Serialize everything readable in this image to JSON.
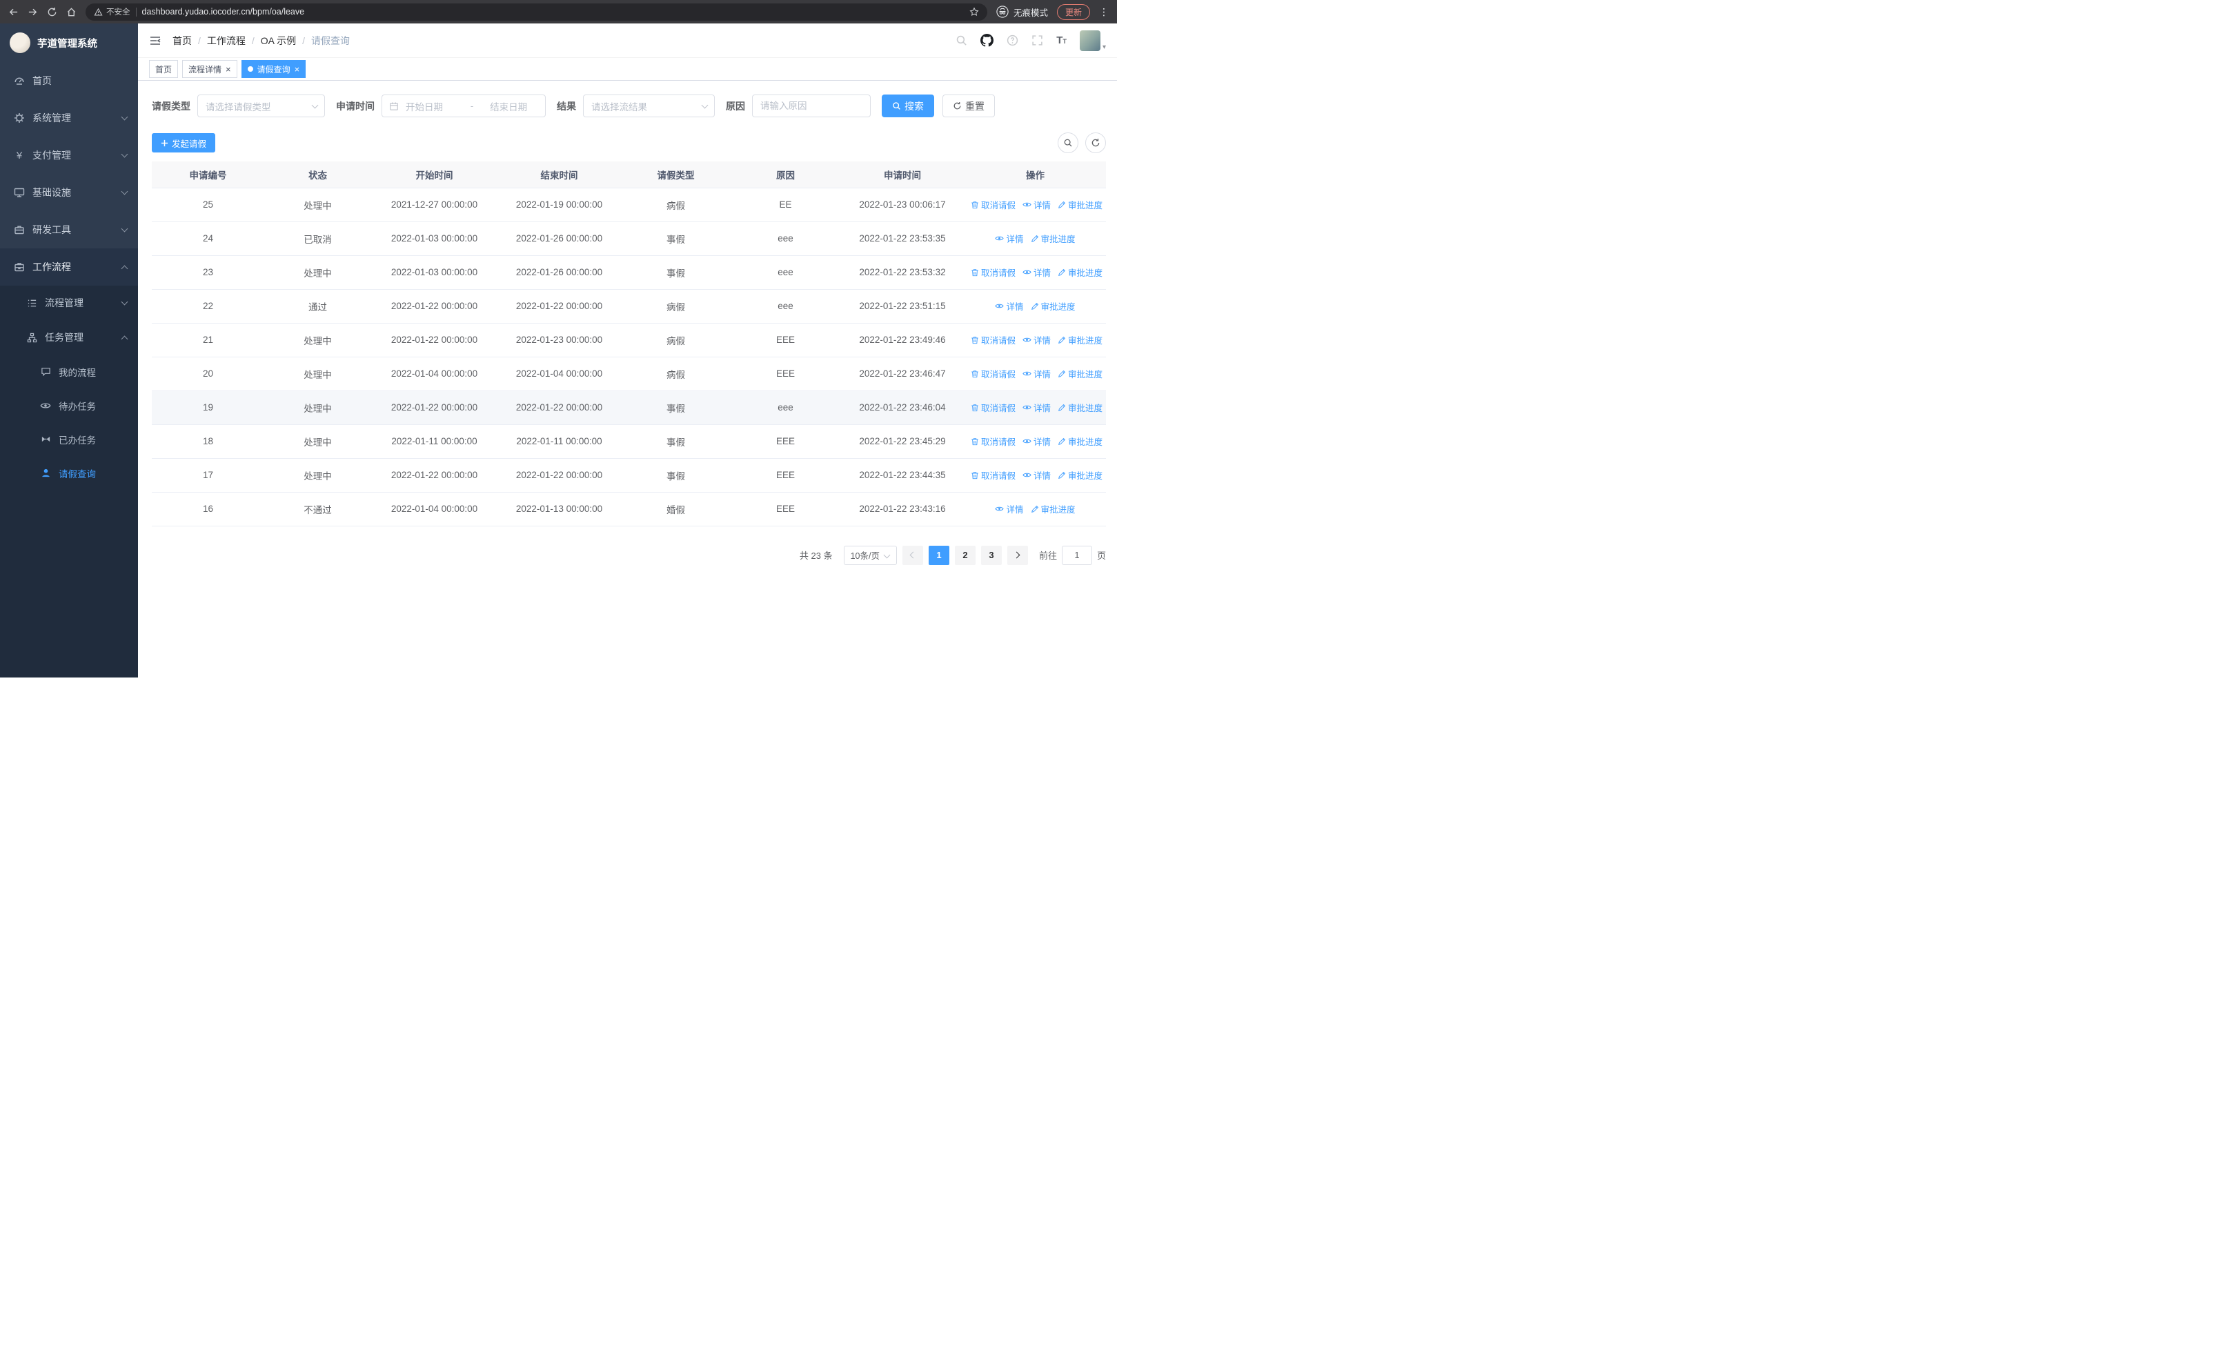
{
  "colors": {
    "primary": "#409eff",
    "sidebar": "#2f3c4f",
    "sidebar_dark": "#202c3d",
    "update_accent": "#e07a6f"
  },
  "browser": {
    "security_label": "不安全",
    "url": "dashboard.yudao.iocoder.cn/bpm/oa/leave",
    "incognito_label": "无痕模式",
    "update_label": "更新"
  },
  "sidebar": {
    "logo_title": "芋道管理系统",
    "items": [
      {
        "label": "首页"
      },
      {
        "label": "系统管理"
      },
      {
        "label": "支付管理"
      },
      {
        "label": "基础设施"
      },
      {
        "label": "研发工具"
      },
      {
        "label": "工作流程"
      }
    ],
    "workflow_children": [
      {
        "label": "流程管理"
      },
      {
        "label": "任务管理"
      }
    ],
    "task_children": [
      {
        "label": "我的流程"
      },
      {
        "label": "待办任务"
      },
      {
        "label": "已办任务"
      },
      {
        "label": "请假查询"
      }
    ]
  },
  "header": {
    "breadcrumb": [
      "首页",
      "工作流程",
      "OA 示例",
      "请假查询"
    ]
  },
  "tabs": [
    {
      "label": "首页"
    },
    {
      "label": "流程详情"
    },
    {
      "label": "请假查询"
    }
  ],
  "filters": {
    "leave_type_label": "请假类型",
    "leave_type_placeholder": "请选择请假类型",
    "apply_time_label": "申请时间",
    "date_start_placeholder": "开始日期",
    "date_separator": "-",
    "date_end_placeholder": "结束日期",
    "result_label": "结果",
    "result_placeholder": "请选择流结果",
    "reason_label": "原因",
    "reason_placeholder": "请输入原因",
    "search_label": "搜索",
    "reset_label": "重置"
  },
  "toolbar": {
    "create_label": "发起请假"
  },
  "table": {
    "columns": [
      "申请编号",
      "状态",
      "开始时间",
      "结束时间",
      "请假类型",
      "原因",
      "申请时间",
      "操作"
    ],
    "action_labels": {
      "cancel": "取消请假",
      "detail": "详情",
      "progress": "审批进度"
    },
    "rows": [
      {
        "id": "25",
        "status": "处理中",
        "start": "2021-12-27 00:00:00",
        "end": "2022-01-19 00:00:00",
        "type": "病假",
        "reason": "EE",
        "applied": "2022-01-23 00:06:17",
        "actions": [
          "cancel",
          "detail",
          "progress"
        ]
      },
      {
        "id": "24",
        "status": "已取消",
        "start": "2022-01-03 00:00:00",
        "end": "2022-01-26 00:00:00",
        "type": "事假",
        "reason": "eee",
        "applied": "2022-01-22 23:53:35",
        "actions": [
          "detail",
          "progress"
        ]
      },
      {
        "id": "23",
        "status": "处理中",
        "start": "2022-01-03 00:00:00",
        "end": "2022-01-26 00:00:00",
        "type": "事假",
        "reason": "eee",
        "applied": "2022-01-22 23:53:32",
        "actions": [
          "cancel",
          "detail",
          "progress"
        ]
      },
      {
        "id": "22",
        "status": "通过",
        "start": "2022-01-22 00:00:00",
        "end": "2022-01-22 00:00:00",
        "type": "病假",
        "reason": "eee",
        "applied": "2022-01-22 23:51:15",
        "actions": [
          "detail",
          "progress"
        ]
      },
      {
        "id": "21",
        "status": "处理中",
        "start": "2022-01-22 00:00:00",
        "end": "2022-01-23 00:00:00",
        "type": "病假",
        "reason": "EEE",
        "applied": "2022-01-22 23:49:46",
        "actions": [
          "cancel",
          "detail",
          "progress"
        ]
      },
      {
        "id": "20",
        "status": "处理中",
        "start": "2022-01-04 00:00:00",
        "end": "2022-01-04 00:00:00",
        "type": "病假",
        "reason": "EEE",
        "applied": "2022-01-22 23:46:47",
        "actions": [
          "cancel",
          "detail",
          "progress"
        ]
      },
      {
        "id": "19",
        "status": "处理中",
        "start": "2022-01-22 00:00:00",
        "end": "2022-01-22 00:00:00",
        "type": "事假",
        "reason": "eee",
        "applied": "2022-01-22 23:46:04",
        "actions": [
          "cancel",
          "detail",
          "progress"
        ],
        "highlighted": true
      },
      {
        "id": "18",
        "status": "处理中",
        "start": "2022-01-11 00:00:00",
        "end": "2022-01-11 00:00:00",
        "type": "事假",
        "reason": "EEE",
        "applied": "2022-01-22 23:45:29",
        "actions": [
          "cancel",
          "detail",
          "progress"
        ]
      },
      {
        "id": "17",
        "status": "处理中",
        "start": "2022-01-22 00:00:00",
        "end": "2022-01-22 00:00:00",
        "type": "事假",
        "reason": "EEE",
        "applied": "2022-01-22 23:44:35",
        "actions": [
          "cancel",
          "detail",
          "progress"
        ]
      },
      {
        "id": "16",
        "status": "不通过",
        "start": "2022-01-04 00:00:00",
        "end": "2022-01-13 00:00:00",
        "type": "婚假",
        "reason": "EEE",
        "applied": "2022-01-22 23:43:16",
        "actions": [
          "detail",
          "progress"
        ]
      }
    ]
  },
  "pagination": {
    "total_text": "共 23 条",
    "page_size_label": "10条/页",
    "pages": [
      "1",
      "2",
      "3"
    ],
    "active_page": "1",
    "goto_label": "前往",
    "goto_value": "1",
    "goto_unit": "页"
  }
}
